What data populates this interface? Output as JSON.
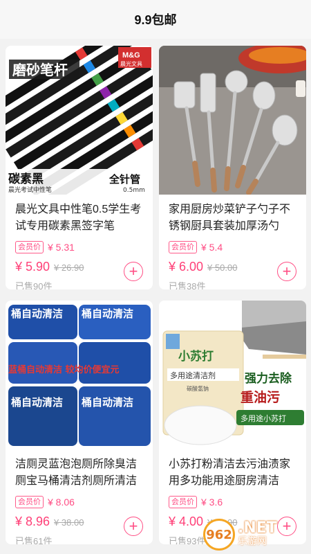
{
  "header": {
    "title": "9.9包邮"
  },
  "products": [
    {
      "name": "晨光文具中性笔0.5学生考试专用碳素黑签字笔",
      "member_tag": "会员价",
      "member_price": "¥ 5.31",
      "price": "¥ 5.90",
      "original_price": "¥ 26.90",
      "sold": "已售90件",
      "image": {
        "brand": "M&G",
        "brand_sub": "晨光文具",
        "banner": "磨砂笔杆",
        "caption_left": "碳素黑",
        "caption_left_sub": "晨光考试中性笔",
        "caption_right": "全针管",
        "caption_right_sub": "0.5mm"
      }
    },
    {
      "name": "家用厨房炒菜铲子勺子不锈钢厨具套装加厚汤勺",
      "member_tag": "会员价",
      "member_price": "¥ 5.4",
      "price": "¥ 6.00",
      "original_price": "¥ 50.00",
      "sold": "已售38件",
      "image": {}
    },
    {
      "name": "洁厕灵蓝泡泡厕所除臭洁厕宝马桶清洁剂厕所清洁",
      "member_tag": "会员价",
      "member_price": "¥ 8.06",
      "price": "¥ 8.96",
      "original_price": "¥ 38.00",
      "sold": "已售61件",
      "image": {
        "pack_text": "桶自动清洁",
        "overlay": "蓝桶自动清洁 较均价便宜元"
      }
    },
    {
      "name": "小苏打粉清洁去污油渍家用多功能用途厨房清洁",
      "member_tag": "会员价",
      "member_price": "¥ 3.6",
      "price": "¥ 4.00",
      "original_price": "¥ 20.00",
      "sold": "已售93件",
      "image": {
        "bag_title": "小苏打",
        "bag_label": "多用途清洁剂",
        "bag_sub": "碳酸氢钠",
        "slogan_1": "强力去除",
        "slogan_2": "重油污",
        "slogan_3": "多用途小苏打"
      }
    }
  ],
  "watermark": {
    "logo": "962",
    "big": ".NET",
    "small": "乐游网"
  },
  "colors": {
    "accent": "#ff4d84",
    "price": "#ff3f77",
    "muted": "#aaaaaa",
    "background": "#f2f2f2"
  }
}
